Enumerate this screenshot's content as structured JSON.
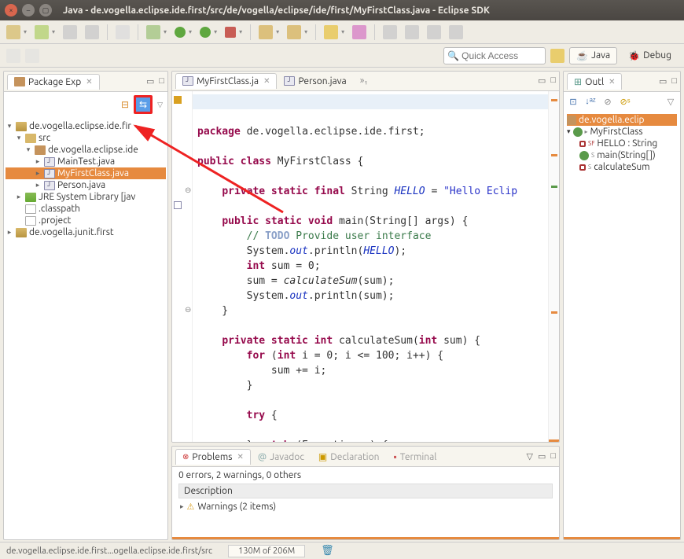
{
  "window": {
    "title": "Java - de.vogella.eclipse.ide.first/src/de/vogella/eclipse/ide/first/MyFirstClass.java - Eclipse SDK"
  },
  "quick_access": {
    "placeholder": "Quick Access"
  },
  "perspectives": {
    "java": "Java",
    "debug": "Debug"
  },
  "package_explorer": {
    "title": "Package Exp",
    "tree": {
      "proj1": "de.vogella.eclipse.ide.fir",
      "src": "src",
      "pkg": "de.vogella.eclipse.ide",
      "f1": "MainTest.java",
      "f2": "MyFirstClass.java",
      "f3": "Person.java",
      "jre": "JRE System Library [jav",
      "classpath": ".classpath",
      "project": ".project",
      "proj2": "de.vogella.junit.first"
    }
  },
  "editor": {
    "tabs": {
      "t1": "MyFirstClass.ja",
      "t2": "Person.java",
      "more": "»₁"
    }
  },
  "outline": {
    "title": "Outl",
    "pkg": "de.vogella.eclip",
    "class": "MyFirstClass",
    "field": "HELLO : String",
    "m1": "main(String[])",
    "m2": "calculateSum"
  },
  "problems": {
    "tabs": {
      "t1": "Problems",
      "t2": "Javadoc",
      "t3": "Declaration",
      "t4": "Terminal"
    },
    "summary": "0 errors, 2 warnings, 0 others",
    "desc_header": "Description",
    "warnings": "Warnings (2 items)"
  },
  "status": {
    "path": "de.vogella.eclipse.ide.first...ogella.eclipse.ide.first/src",
    "heap": "130M of 206M"
  },
  "code_lines": {
    "l1a": "package",
    "l1b": " de.vogella.eclipse.ide.first;",
    "l3a": "public class",
    "l3b": " MyFirstClass {",
    "l5a": "private static final",
    "l5b": " String ",
    "l5c": "HELLO",
    "l5d": " = ",
    "l5e": "\"Hello Eclip",
    "l7a": "public static void",
    "l7b": " main(String[] args) {",
    "l8a": "// ",
    "l8b": "TODO",
    "l8c": " Provide user interface",
    "l9a": "        System.",
    "l9b": "out",
    "l9c": ".println(",
    "l9d": "HELLO",
    "l9e": ");",
    "l10a": "int",
    "l10b": " sum = 0;",
    "l11a": "        sum = ",
    "l11b": "calculateSum",
    "l11c": "(sum);",
    "l12a": "        System.",
    "l12b": "out",
    "l12c": ".println(sum);",
    "l13": "    }",
    "l15a": "private static int",
    "l15b": " calculateSum(",
    "l15c": "int",
    "l15d": " sum) {",
    "l16a": "for",
    "l16b": " (",
    "l16c": "int",
    "l16d": " i = 0; i <= 100; i++) {",
    "l17": "            sum += i;",
    "l18": "        }",
    "l20a": "try",
    "l20b": " {",
    "l22a": "        } ",
    "l22b": "catch",
    "l22c": " (Exception e) {"
  }
}
